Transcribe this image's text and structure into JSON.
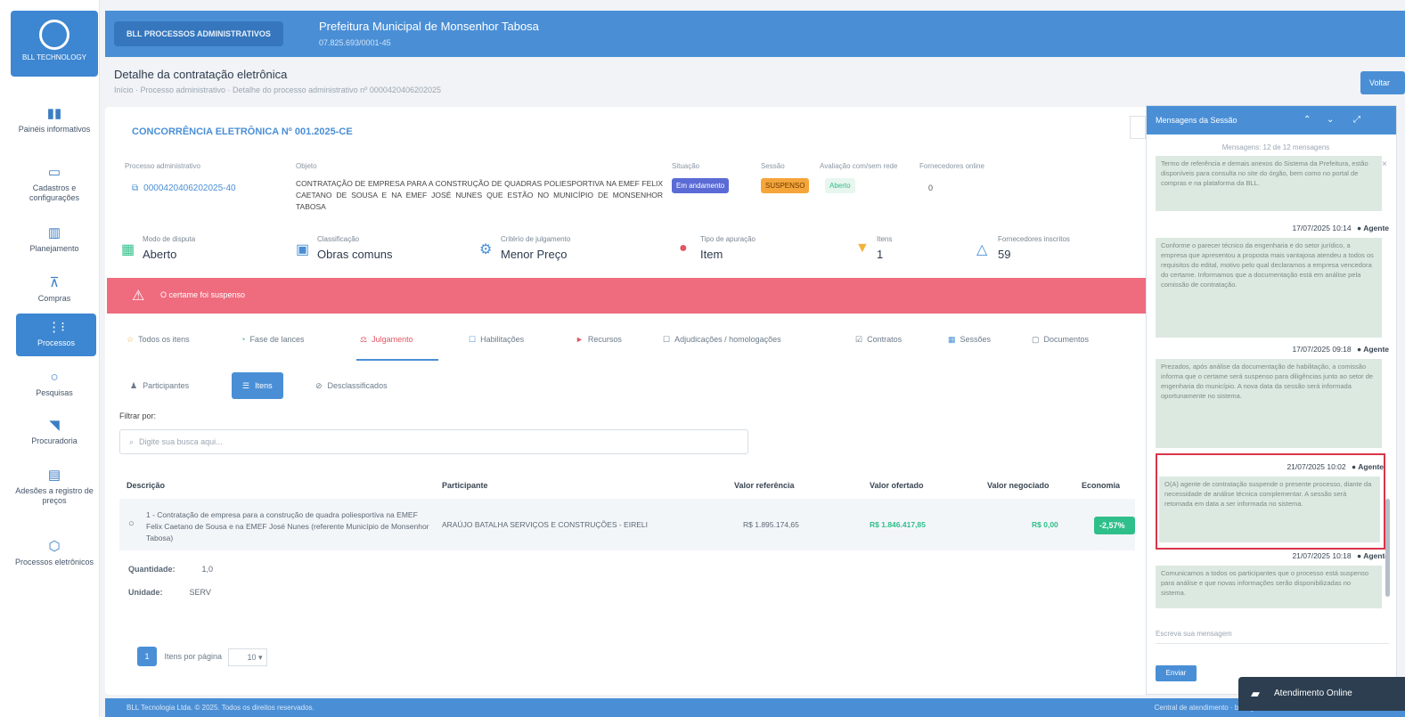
{
  "sidebar": {
    "brand": "BLL TECHNOLOGY",
    "items": [
      {
        "icon": "bar-chart-icon",
        "label": "Painéis informativos"
      },
      {
        "icon": "monitor-icon",
        "label": "Cadastros e configurações"
      },
      {
        "icon": "calendar-icon",
        "label": "Planejamento"
      },
      {
        "icon": "cart-icon",
        "label": "Compras"
      },
      {
        "icon": "tree-icon",
        "label": "Processos"
      },
      {
        "icon": "search-icon",
        "label": "Pesquisas"
      },
      {
        "icon": "megaphone-icon",
        "label": "Procuradoria"
      },
      {
        "icon": "document-icon",
        "label": "Adesões a registro de preços"
      },
      {
        "icon": "shield-icon",
        "label": "Processos eletrônicos"
      }
    ]
  },
  "topbar": {
    "module": "BLL PROCESSOS ADMINISTRATIVOS",
    "org": "Prefeitura Municipal de Monsenhor Tabosa",
    "org_sub": "07.825.693/0001-45"
  },
  "page": {
    "title": "Detalhe da contratação eletrônica",
    "breadcrumb": "Início · Processo administrativo · Detalhe do processo administrativo nº 0000420406202025",
    "top_button": "Voltar"
  },
  "contract": {
    "title": "CONCORRÊNCIA ELETRÔNICA Nº 001.2025-CE",
    "process_label": "Processo administrativo",
    "process_value": "0000420406202025-40",
    "objeto_label": "Objeto",
    "objeto_text": "CONTRATAÇÃO DE EMPRESA PARA A CONSTRUÇÃO DE QUADRAS POLIESPORTIVA NA EMEF FELIX CAETANO DE SOUSA E NA EMEF JOSÉ NUNES QUE ESTÃO NO MUNICÍPIO DE MONSENHOR TABOSA",
    "situacao_label": "Situação",
    "situacao_value": "Em andamento",
    "sessao_label": "Sessão",
    "sessao_value": "SUSPENSO",
    "avaliacao_label": "Avaliação com/sem rede",
    "avaliacao_value": "Aberto",
    "fornecedores_label": "Fornecedores online",
    "fornecedores_value": "0"
  },
  "stats": [
    {
      "icon": "building-icon",
      "label": "Modo de disputa",
      "value": "Aberto",
      "color": "#2fbf8a"
    },
    {
      "icon": "list-icon",
      "label": "Classificação",
      "value": "Obras comuns",
      "color": "#4a8fd6"
    },
    {
      "icon": "gavel-icon",
      "label": "Critério de julgamento",
      "value": "Menor Preço",
      "color": "#4a8fd6"
    },
    {
      "icon": "tag-icon",
      "label": "Tipo de apuração",
      "value": "Item",
      "color": "#e25563"
    },
    {
      "icon": "basket-icon",
      "label": "Itens",
      "value": "1",
      "color": "#f2b23c"
    },
    {
      "icon": "users-icon",
      "label": "Fornecedores inscritos",
      "value": "59",
      "color": "#4a8fd6"
    }
  ],
  "alert": {
    "text": "O certame foi suspenso"
  },
  "tabs": [
    "Todos os itens",
    "Fase de lances",
    "Julgamento",
    "Habilitações",
    "Recursos",
    "Adjudicações / homologações",
    "Contratos",
    "Sessões",
    "Documentos"
  ],
  "subtabs": [
    "Participantes",
    "Itens",
    "Desclassificados"
  ],
  "filter": {
    "label": "Filtrar por:",
    "placeholder": "Digite sua busca aqui..."
  },
  "table": {
    "headers": [
      "Descrição",
      "Participante",
      "Valor referência",
      "Valor ofertado",
      "Valor negociado",
      "Economia"
    ],
    "row": {
      "descricao": "1 - Contratação de empresa para a construção de quadra poliesportiva na EMEF Felix Caetano de Sousa e na EMEF José Nunes (referente Município de Monsenhor Tabosa)",
      "participante": "ARAÚJO BATALHA SERVIÇOS E CONSTRUÇÕES - EIRELI",
      "valor_referencia": "R$ 1.895.174,65",
      "valor_ofertado": "R$ 1.846.417,85",
      "valor_negociado": "R$ 0,00",
      "economia": "-2,57% ↓"
    },
    "quantidade_label": "Quantidade:",
    "quantidade_value": "1,0",
    "unidade_label": "Unidade:",
    "unidade_value": "SERV"
  },
  "pager": {
    "page": "1",
    "per_page_label": "Itens por página",
    "per_page_value": "10"
  },
  "footer": {
    "left": "BLL Tecnologia Ltda. © 2025. Todos os direitos reservados.",
    "right": "Central de atendimento · bll.org.br"
  },
  "chat": {
    "title": "Mensagens da Sessão",
    "meta": "Mensagens: 12 de 12 mensagens",
    "messages": [
      {
        "time": "",
        "author": "",
        "text": "Termo de referência e demais anexos do Sistema da Prefeitura, estão disponíveis para consulta no site do órgão, bem como no portal de compras e na plataforma da BLL."
      },
      {
        "time": "17/07/2025 10:14",
        "author": "Agente",
        "text": "Conforme o parecer técnico da engenharia e do setor jurídico, a empresa que apresentou a proposta mais vantajosa atendeu a todos os requisitos do edital, motivo pelo qual declaramos a empresa vencedora do certame. Informamos que a documentação está em análise pela comissão de contratação."
      },
      {
        "time": "17/07/2025 09:18",
        "author": "Agente",
        "text": "Prezados, após análise da documentação de habilitação, a comissão informa que o certame será suspenso para diligências junto ao setor de engenharia do município. A nova data da sessão será informada oportunamente no sistema."
      },
      {
        "time": "21/07/2025 10:02",
        "author": "Agente",
        "text": "O(A) agente de contratação suspende o presente processo, diante da necessidade de análise técnica complementar. A sessão será retomada em data a ser informada no sistema."
      },
      {
        "time": "21/07/2025 10:18",
        "author": "Agente",
        "text": "Comunicamos a todos os participantes que o processo está suspenso para análise e que novas informações serão disponibilizadas no sistema."
      }
    ],
    "input_placeholder": "Escreva sua mensagem",
    "send": "Enviar"
  },
  "online": {
    "label": "Atendimento Online"
  }
}
